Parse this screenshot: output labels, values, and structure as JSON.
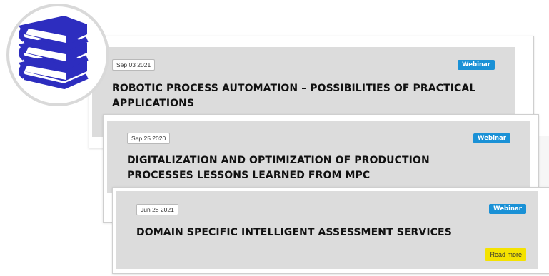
{
  "logo": {
    "icon": "books-icon",
    "colors": {
      "book": "#2d2dbf",
      "pages": "#ffffff",
      "circle": "#d9d9d9"
    }
  },
  "colors": {
    "card_bg": "#dcdcdc",
    "badge": "#1a91d6",
    "read_more": "#f4e200"
  },
  "cards": [
    {
      "date": "Sep 03 2021",
      "type": "Webinar",
      "title": "ROBOTIC PROCESS AUTOMATION – POSSIBILITIES OF PRACTICAL APPLICATIONS"
    },
    {
      "date": "Sep 25 2020",
      "type": "Webinar",
      "title": "DIGITALIZATION AND OPTIMIZATION OF PRODUCTION PROCESSES LESSONS LEARNED FROM MPC"
    },
    {
      "date": "Jun 28 2021",
      "type": "Webinar",
      "title": "DOMAIN SPECIFIC INTELLIGENT ASSESSMENT SERVICES",
      "read_more": "Read more"
    }
  ]
}
